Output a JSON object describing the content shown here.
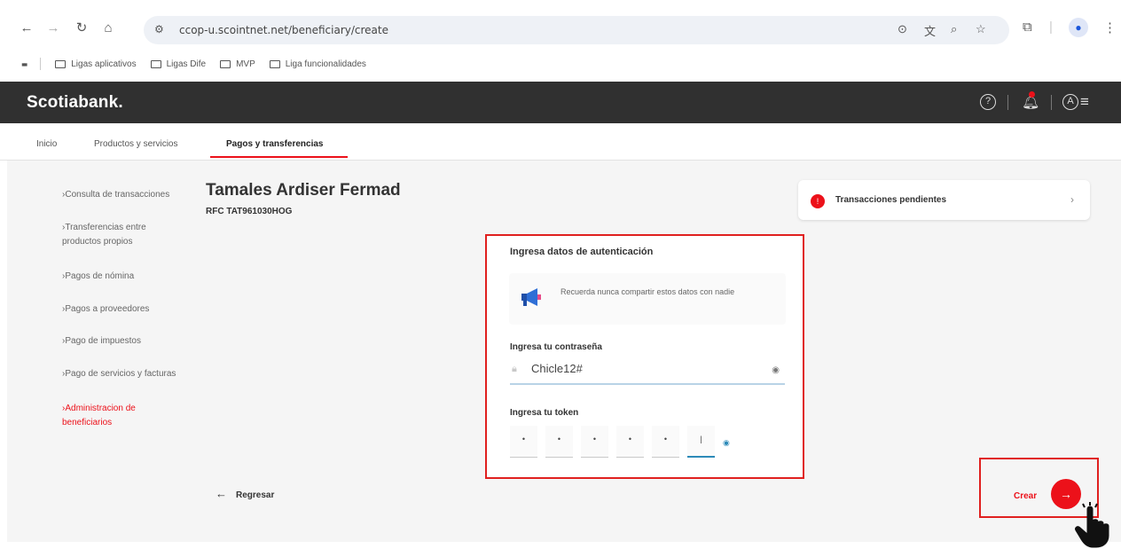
{
  "browser": {
    "url": "ccop-u.scointnet.net/beneficiary/create",
    "bookmarks": [
      "Ligas aplicativos",
      "Ligas Dife",
      "MVP",
      "Liga funcionalidades"
    ]
  },
  "header": {
    "brand": "Scotiabank.",
    "help_icon": "?",
    "profile_icon": "A"
  },
  "subnav": {
    "tabs": [
      "Inicio",
      "Productos y servicios",
      "Pagos y transferencias"
    ],
    "active_tab": "Pagos y transferencias"
  },
  "sidebar": {
    "items": [
      {
        "label": "Consulta de transacciones",
        "active": false
      },
      {
        "label": "Transferencias entre productos propios",
        "active": false
      },
      {
        "label": "Pagos de nómina",
        "active": false
      },
      {
        "label": "Pagos a proveedores",
        "active": false
      },
      {
        "label": "Pago de impuestos",
        "active": false
      },
      {
        "label": "Pago de servicios y facturas",
        "active": false
      },
      {
        "label": "Administracion de beneficiarios",
        "active": true
      }
    ]
  },
  "beneficiary": {
    "name": "Tamales Ardiser Fermad",
    "rfc": "RFC TAT961030HOG"
  },
  "pending": {
    "label": "Transacciones pendientes"
  },
  "auth": {
    "title": "Ingresa datos de autenticación",
    "notice": "Recuerda nunca compartir estos datos con nadie",
    "password_label": "Ingresa tu contraseña",
    "password_value": "Chicle12#",
    "token_label": "Ingresa tu token",
    "token_digits": [
      "•",
      "•",
      "•",
      "•",
      "•",
      "|"
    ]
  },
  "actions": {
    "back_label": "Regresar",
    "create_label": "Crear",
    "create_arrow": "→"
  },
  "colors": {
    "brand_red": "#ec111a",
    "highlight_red": "#e0201f",
    "topbar": "#303030"
  }
}
